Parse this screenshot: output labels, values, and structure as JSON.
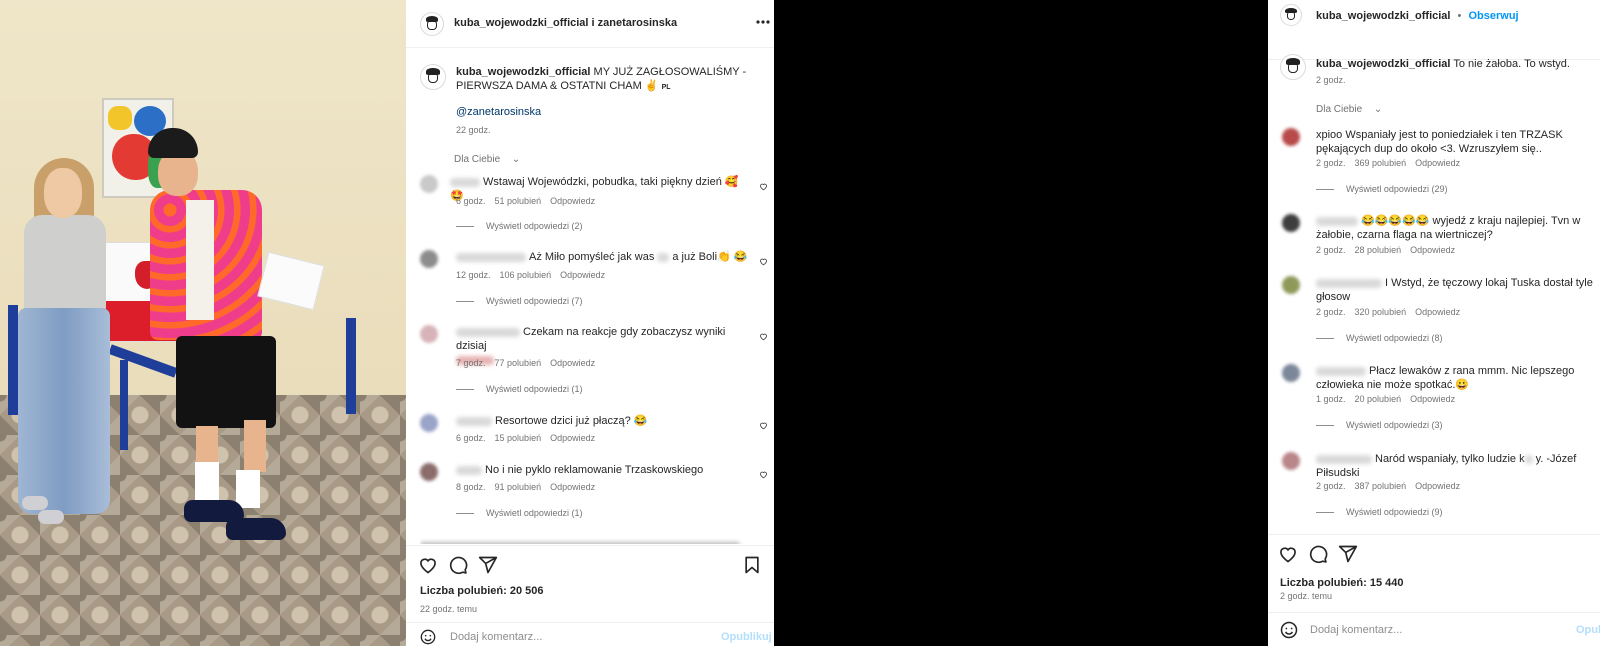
{
  "left_post": {
    "header": {
      "title": "kuba_wojewodzki_official i zanetarosinska",
      "more_icon": "more-dots-icon"
    },
    "caption": {
      "username": "kuba_wojewodzki_official",
      "text": "MY JUŻ ZAGŁOSOWALIŚMY - PIERWSZA DAMA & OSTATNI CHAM ✌️",
      "flag_label": "PL",
      "mention": "@zanetarosinska",
      "time": "22 godz."
    },
    "filter": "Dla Ciebie",
    "comments": [
      {
        "text": "Wstawaj Wojewódzki, pobudka, taki piękny dzień 🥰🤩",
        "time": "6 godz.",
        "likes": "51 polubień",
        "reply": "Odpowiedz",
        "replies": "Wyświetl odpowiedzi (2)",
        "avatar_color": "#c9c9c9"
      },
      {
        "text": "Aż Miło pomyśleć jak was ",
        "text_after": "a już Boli👏 😂",
        "time": "12 godz.",
        "likes": "106 polubień",
        "reply": "Odpowiedz",
        "replies": "Wyświetl odpowiedzi (7)",
        "avatar_color": "#8c8c8c"
      },
      {
        "text": "Czekam na reakcje gdy zobaczysz wyniki dzisiaj",
        "time": "7 godz.",
        "likes": "77 polubień",
        "reply": "Odpowiedz",
        "replies": "Wyświetl odpowiedzi (1)",
        "avatar_color": "#d7b3b8"
      },
      {
        "text": "Resortowe dzici już płaczą? 😂",
        "time": "6 godz.",
        "likes": "15 polubień",
        "reply": "Odpowiedz",
        "replies": "",
        "avatar_color": "#9aa3c8"
      },
      {
        "text": "No i nie pyklo reklamowanie Trzaskowskiego",
        "time": "8 godz.",
        "likes": "91 polubień",
        "reply": "Odpowiedz",
        "replies": "Wyświetl odpowiedzi (1)",
        "avatar_color": "#8a6c6c"
      }
    ],
    "likes_count": "Liczba polubień: 20 506",
    "posted_ago": "22 godz. temu",
    "add_comment_placeholder": "Dodaj komentarz...",
    "publish_label": "Opublikuj"
  },
  "right_post": {
    "header": {
      "username": "kuba_wojewodzki_official",
      "dot": "•",
      "follow": "Obserwuj"
    },
    "caption": {
      "username": "kuba_wojewodzki_official",
      "text": "To nie żałoba. To wstyd.",
      "time": "2 godz."
    },
    "filter": "Dla Ciebie",
    "comments": [
      {
        "user": "xpioo",
        "text": "Wspaniały jest to poniedziałek i ten TRZASK pękających dup do około <3. Wzruszyłem się..",
        "time": "2 godz.",
        "likes": "369 polubień",
        "reply": "Odpowiedz",
        "replies": "Wyświetl odpowiedzi (29)",
        "avatar_color": "#b84a4a"
      },
      {
        "user": "",
        "text": "😂😂😂😂😂 wyjedź z kraju najlepiej. Tvn w żałobie, czarna flaga na wiertniczej?",
        "time": "2 godz.",
        "likes": "28 polubień",
        "reply": "Odpowiedz",
        "replies": "",
        "avatar_color": "#3d3d3d"
      },
      {
        "user": "",
        "text": "I Wstyd, że tęczowy lokaj Tuska dostał tyle głosow",
        "time": "2 godz.",
        "likes": "320 polubień",
        "reply": "Odpowiedz",
        "replies": "Wyświetl odpowiedzi (8)",
        "avatar_color": "#8f9a5a"
      },
      {
        "user": "",
        "text": "Płacz lewaków z rana mmm. Nic lepszego człowieka nie może spotkać.😀",
        "time": "1 godz.",
        "likes": "20 polubień",
        "reply": "Odpowiedz",
        "replies": "Wyświetl odpowiedzi (3)",
        "avatar_color": "#7c8799"
      },
      {
        "user": "",
        "text": "Naród wspaniały, tylko ludzie k",
        "text_after": "y. -Józef Piłsudski",
        "time": "2 godz.",
        "likes": "387 polubień",
        "reply": "Odpowiedz",
        "replies": "Wyświetl odpowiedzi (9)",
        "avatar_color": "#b9868a"
      }
    ],
    "likes_count": "Liczba polubień: 15 440",
    "posted_ago": "2 godz. temu",
    "add_comment_placeholder": "Dodaj komentarz...",
    "publish_label": "Opublikuj"
  }
}
